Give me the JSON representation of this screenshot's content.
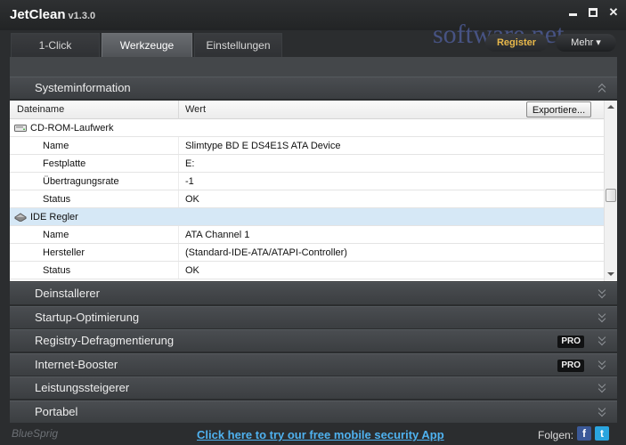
{
  "app": {
    "title": "JetClean",
    "version": "v1.3.0"
  },
  "window": {
    "minimize_icon": "minimize-icon",
    "maximize_icon": "maximize-icon",
    "close_icon": "close-icon"
  },
  "tabs": [
    {
      "label": "1-Click",
      "active": false
    },
    {
      "label": "Werkzeuge",
      "active": true
    },
    {
      "label": "Einstellungen",
      "active": false
    }
  ],
  "header_buttons": {
    "register": "Register",
    "more": "Mehr ▾"
  },
  "watermark": "software.net",
  "sections": {
    "systeminfo": "Systeminformation",
    "list": [
      {
        "label": "Deinstallerer",
        "pro": ""
      },
      {
        "label": "Startup-Optimierung",
        "pro": ""
      },
      {
        "label": "Registry-Defragmentierung",
        "pro": "PRO"
      },
      {
        "label": "Internet-Booster",
        "pro": "PRO"
      },
      {
        "label": "Leistungssteigerer",
        "pro": ""
      },
      {
        "label": "Portabel",
        "pro": ""
      }
    ]
  },
  "info": {
    "col_name": "Dateiname",
    "col_value": "Wert",
    "export": "Exportiere...",
    "rows": [
      {
        "type": "group",
        "label": "CD-ROM-Laufwerk",
        "icon": "cdrom-drive-icon"
      },
      {
        "type": "item",
        "name": "Name",
        "value": "Slimtype BD  E  DS4E1S ATA Device"
      },
      {
        "type": "item",
        "name": "Festplatte",
        "value": "E:"
      },
      {
        "type": "item",
        "name": "Übertragungsrate",
        "value": "-1"
      },
      {
        "type": "item",
        "name": "Status",
        "value": "OK"
      },
      {
        "type": "group",
        "label": "IDE Regler",
        "icon": "ide-controller-icon",
        "selected": true
      },
      {
        "type": "item",
        "name": "Name",
        "value": "ATA Channel 1"
      },
      {
        "type": "item",
        "name": "Hersteller",
        "value": "(Standard-IDE-ATA/ATAPI-Controller)"
      },
      {
        "type": "item",
        "name": "Status",
        "value": "OK"
      }
    ]
  },
  "footer": {
    "logo": "BlueSprig",
    "link": "Click here to try our free mobile security App",
    "follow": "Folgen:",
    "facebook_glyph": "f",
    "twitter_glyph": "t"
  }
}
